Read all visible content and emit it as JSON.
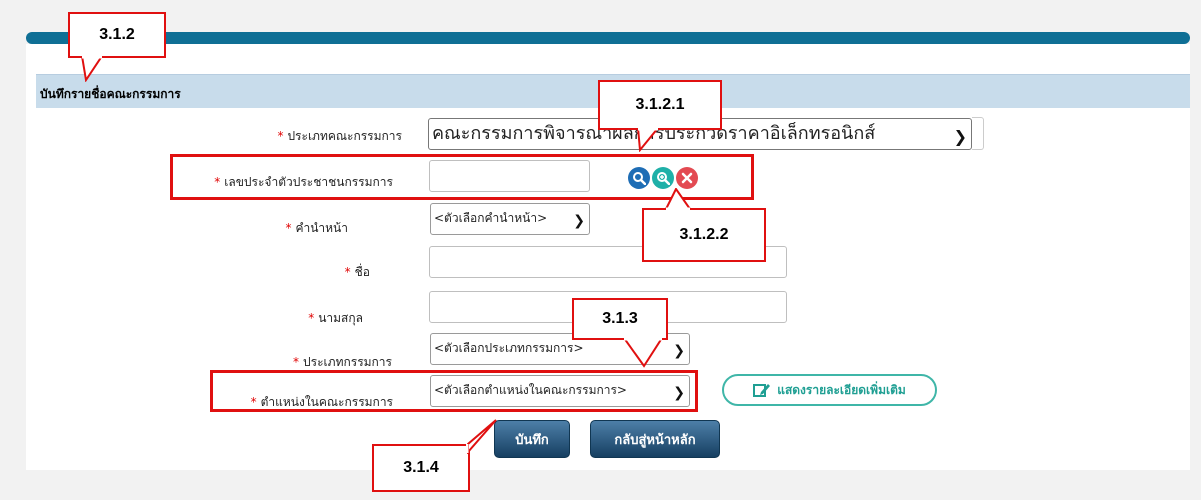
{
  "form": {
    "header_title": "บันทึกรายชื่อคณะกรรมการ",
    "fields": {
      "committee_type": {
        "label": "ประเภทคณะกรรมการ",
        "value": "คณะกรรมการพิจารณาผลการประกวดราคาอิเล็กทรอนิกส์"
      },
      "citizen_id": {
        "label": "เลขประจำตัวประชาชนกรรมการ",
        "value": ""
      },
      "title_prefix": {
        "label": "คำนำหน้า",
        "value": "<ตัวเลือกคำนำหน้า>"
      },
      "first_name": {
        "label": "ชื่อ",
        "value": ""
      },
      "last_name": {
        "label": "นามสกุล",
        "value": ""
      },
      "member_type": {
        "label": "ประเภทกรรมการ",
        "value": "<ตัวเลือกประเภทกรรมการ>"
      },
      "position": {
        "label": "ตำแหน่งในคณะกรรมการ",
        "value": "<ตัวเลือกตำแหน่งในคณะกรรมการ>"
      }
    },
    "required_mark": "*",
    "show_details_label": "แสดงรายละเอียดเพิ่มเติม",
    "save_label": "บันทึก",
    "back_label": "กลับสู่หน้าหลัก"
  },
  "annotations": {
    "a312": "3.1.2",
    "a3121": "3.1.2.1",
    "a3122": "3.1.2.2",
    "a313": "3.1.3",
    "a314": "3.1.4"
  },
  "colors": {
    "top_bar": "#0f6f95",
    "header_bg": "#c8dceb",
    "required": "#e00000",
    "annotation": "#e01010",
    "button": "#1f4c72",
    "details_border": "#3fb6a8"
  },
  "icons": [
    "search-icon",
    "zoom-in-icon",
    "clear-icon",
    "edit-icon"
  ]
}
